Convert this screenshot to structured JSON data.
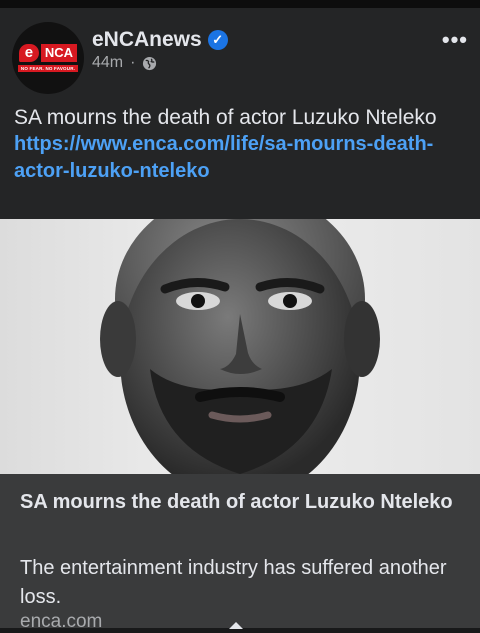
{
  "page": {
    "name": "eNCAnews",
    "time": "44m",
    "separator": "·",
    "logo": {
      "mark": "e",
      "text": "NCA",
      "tagline": "NO FEAR. NO FAVOUR."
    }
  },
  "post": {
    "text": "SA mourns the death of actor Luzuko Nteleko",
    "link": "https://www.enca.com/life/sa-mourns-death-actor-luzuko-nteleko"
  },
  "card": {
    "title": "SA mourns the death of actor Luzuko Nteleko",
    "description": "The entertainment industry has suffered another loss.",
    "domain": "enca.com"
  },
  "icons": {
    "verified": "verified-badge-icon",
    "audience": "globe-icon",
    "more": "more-options-icon"
  },
  "colors": {
    "background": "#242526",
    "link": "#4da1f5",
    "verified": "#1b74e4",
    "brand": "#d71921",
    "card": "#3a3b3c"
  }
}
